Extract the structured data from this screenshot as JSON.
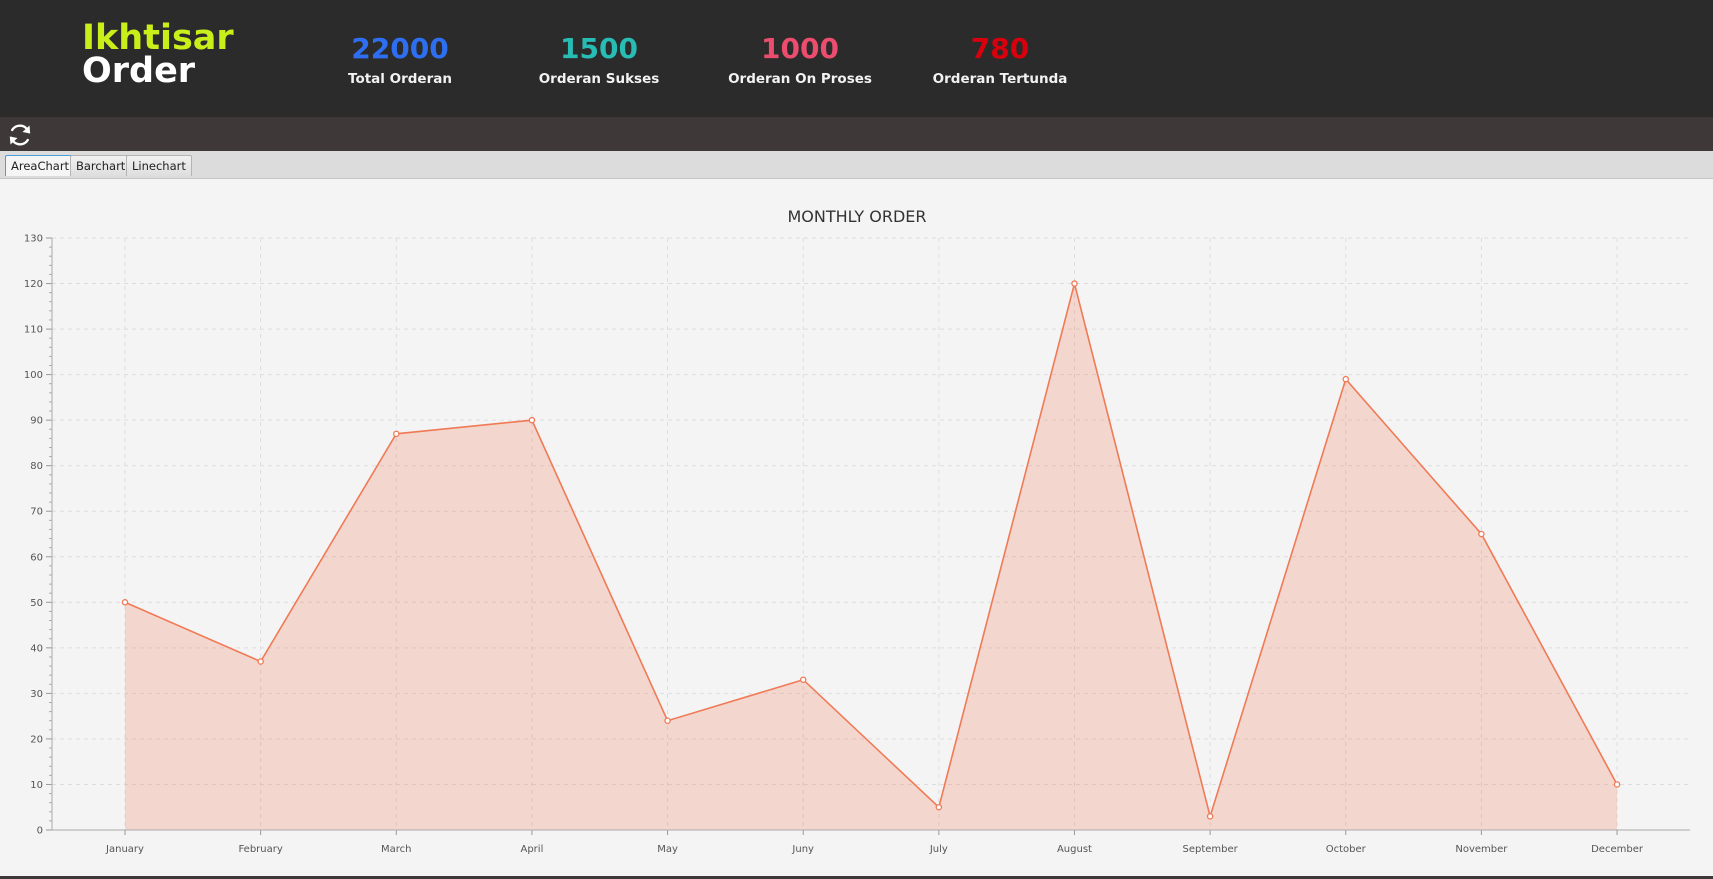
{
  "header": {
    "brand_line1": "Ikhtisar",
    "brand_line2": "Order",
    "stats": [
      {
        "value": "22000",
        "label": "Total Orderan",
        "color": "#2e6ff2"
      },
      {
        "value": "1500",
        "label": "Orderan Sukses",
        "color": "#27bcb4"
      },
      {
        "value": "1000",
        "label": "Orderan On Proses",
        "color": "#ec4d6e"
      },
      {
        "value": "780",
        "label": "Orderan Tertunda",
        "color": "#d7000c"
      }
    ]
  },
  "toolbar": {
    "refresh_icon": "refresh-icon"
  },
  "tabs": [
    {
      "label": "AreaChart",
      "active": true
    },
    {
      "label": "Barchart",
      "active": false
    },
    {
      "label": "Linechart",
      "active": false
    }
  ],
  "chart_data": {
    "type": "area",
    "title": "MONTHLY ORDER",
    "xlabel": "",
    "ylabel": "",
    "categories": [
      "January",
      "February",
      "March",
      "April",
      "May",
      "Juny",
      "July",
      "August",
      "September",
      "October",
      "November",
      "December"
    ],
    "series": [
      {
        "values": [
          50,
          37,
          87,
          90,
          24,
          33,
          5,
          120,
          3,
          99,
          65,
          10
        ],
        "color": "#f07a56"
      }
    ],
    "ylim": [
      0,
      130
    ],
    "yticks": [
      "0",
      "10",
      "20",
      "30",
      "40",
      "50",
      "60",
      "70",
      "80",
      "90",
      "100",
      "110",
      "120",
      "130"
    ],
    "grid": true,
    "legend": "none"
  }
}
